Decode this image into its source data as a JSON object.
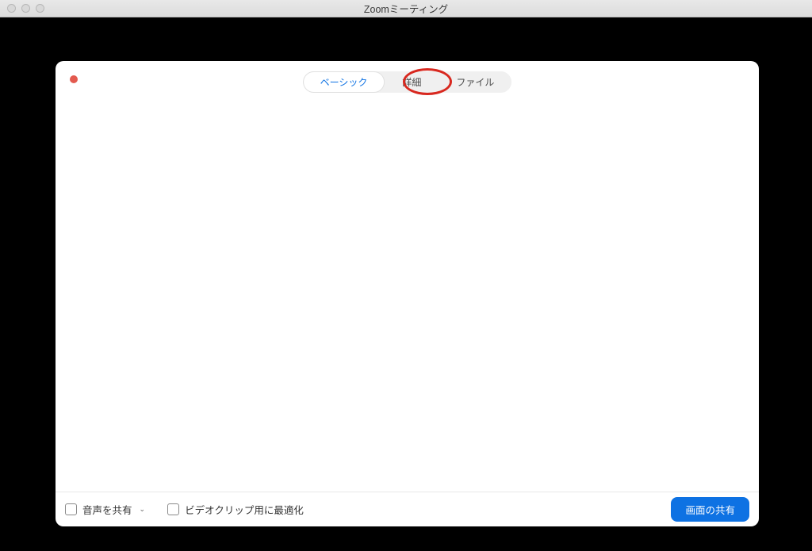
{
  "window": {
    "title": "Zoomミーティング"
  },
  "tabs": {
    "basic": "ベーシック",
    "advanced": "詳細",
    "files": "ファイル"
  },
  "footer": {
    "share_audio": "音声を共有",
    "optimize_video": "ビデオクリップ用に最適化",
    "share_button": "画面の共有"
  }
}
